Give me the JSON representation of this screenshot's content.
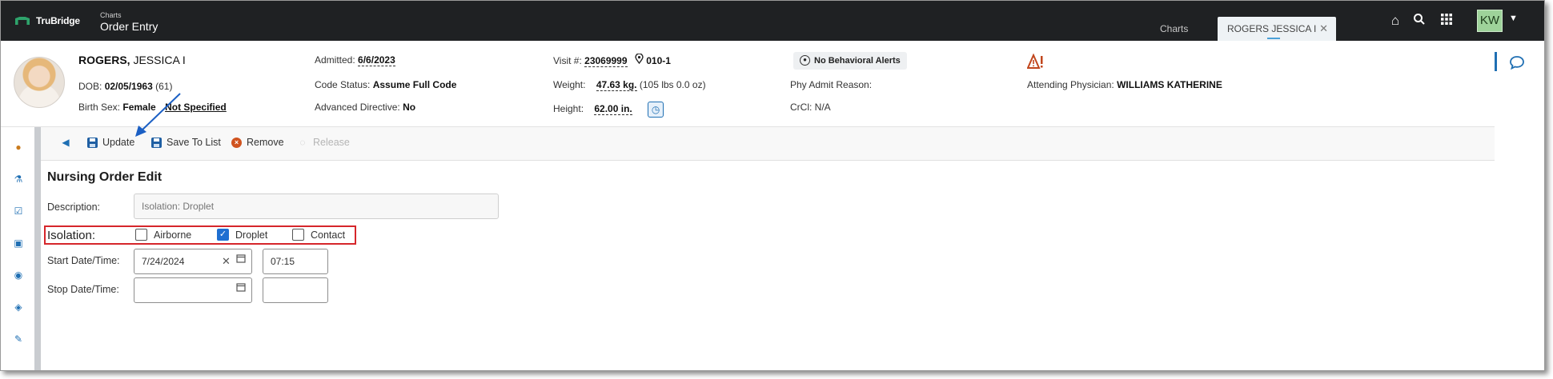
{
  "app": {
    "logo_text": "TruBridge",
    "breadcrumb_sub": "Charts",
    "breadcrumb_title": "Order Entry",
    "user_initials": "KW"
  },
  "tabs": [
    {
      "label": "Charts"
    },
    {
      "label": "ROGERS JESSICA I"
    }
  ],
  "patient": {
    "last_name": "ROGERS,",
    "first_name": " JESSICA I",
    "dob_label": "DOB:",
    "dob": "02/05/1963",
    "age": "(61)",
    "birth_sex_label": "Birth Sex:",
    "birth_sex": "Female",
    "gender_identity": "Not Specified",
    "admitted_label": "Admitted:",
    "admitted": "6/6/2023",
    "code_status_label": "Code Status:",
    "code_status": "Assume Full Code",
    "adv_directive_label": "Advanced Directive:",
    "adv_directive": "No",
    "visit_label": "Visit #:",
    "visit": "23069999",
    "room": "010-1",
    "weight_label": "Weight:",
    "weight": "47.63 kg.",
    "weight_lbs": "(105 lbs 0.0 oz)",
    "height_label": "Height:",
    "height": "62.00 in.",
    "behavioral_alert": "No Behavioral Alerts",
    "phy_admit_label": "Phy Admit Reason:",
    "crcl_label": "CrCl:",
    "crcl": "N/A",
    "attending_label": "Attending Physician:",
    "attending": "WILLIAMS KATHERINE"
  },
  "toolbar": {
    "update": "Update",
    "save_to_list": "Save To List",
    "remove": "Remove",
    "release": "Release"
  },
  "form": {
    "title": "Nursing Order Edit",
    "description_label": "Description:",
    "description_placeholder": "Isolation: Droplet",
    "isolation_label": "Isolation:",
    "options": [
      {
        "label": "Airborne",
        "checked": false
      },
      {
        "label": "Droplet",
        "checked": true
      },
      {
        "label": "Contact",
        "checked": false
      }
    ],
    "start_label": "Start Date/Time:",
    "start_date": "7/24/2024",
    "start_time": "07:15",
    "stop_label": "Stop Date/Time:",
    "stop_date": "",
    "stop_time": ""
  }
}
